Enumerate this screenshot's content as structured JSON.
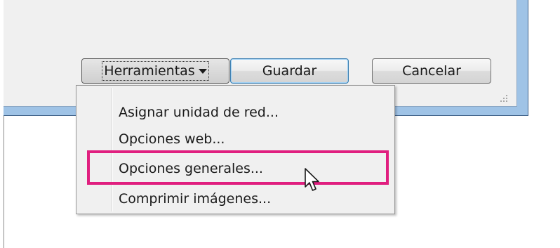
{
  "dialog": {
    "buttons": {
      "tools_label": "Herramientas",
      "save_label": "Guardar",
      "cancel_label": "Cancelar"
    }
  },
  "menu": {
    "items": [
      {
        "label": "Asignar unidad de red..."
      },
      {
        "label": "Opciones web..."
      },
      {
        "label": "Opciones generales..."
      },
      {
        "label": "Comprimir imágenes..."
      }
    ],
    "highlighted_item": "Opciones generales..."
  },
  "colors": {
    "highlight": "#e01f7f",
    "window_frame": "#9fc3e6",
    "dialog_background": "#f0f0f0"
  },
  "icons": {
    "dropdown": "caret-down-icon",
    "pointer": "mouse-pointer-icon",
    "resize": "resize-grip-icon"
  }
}
